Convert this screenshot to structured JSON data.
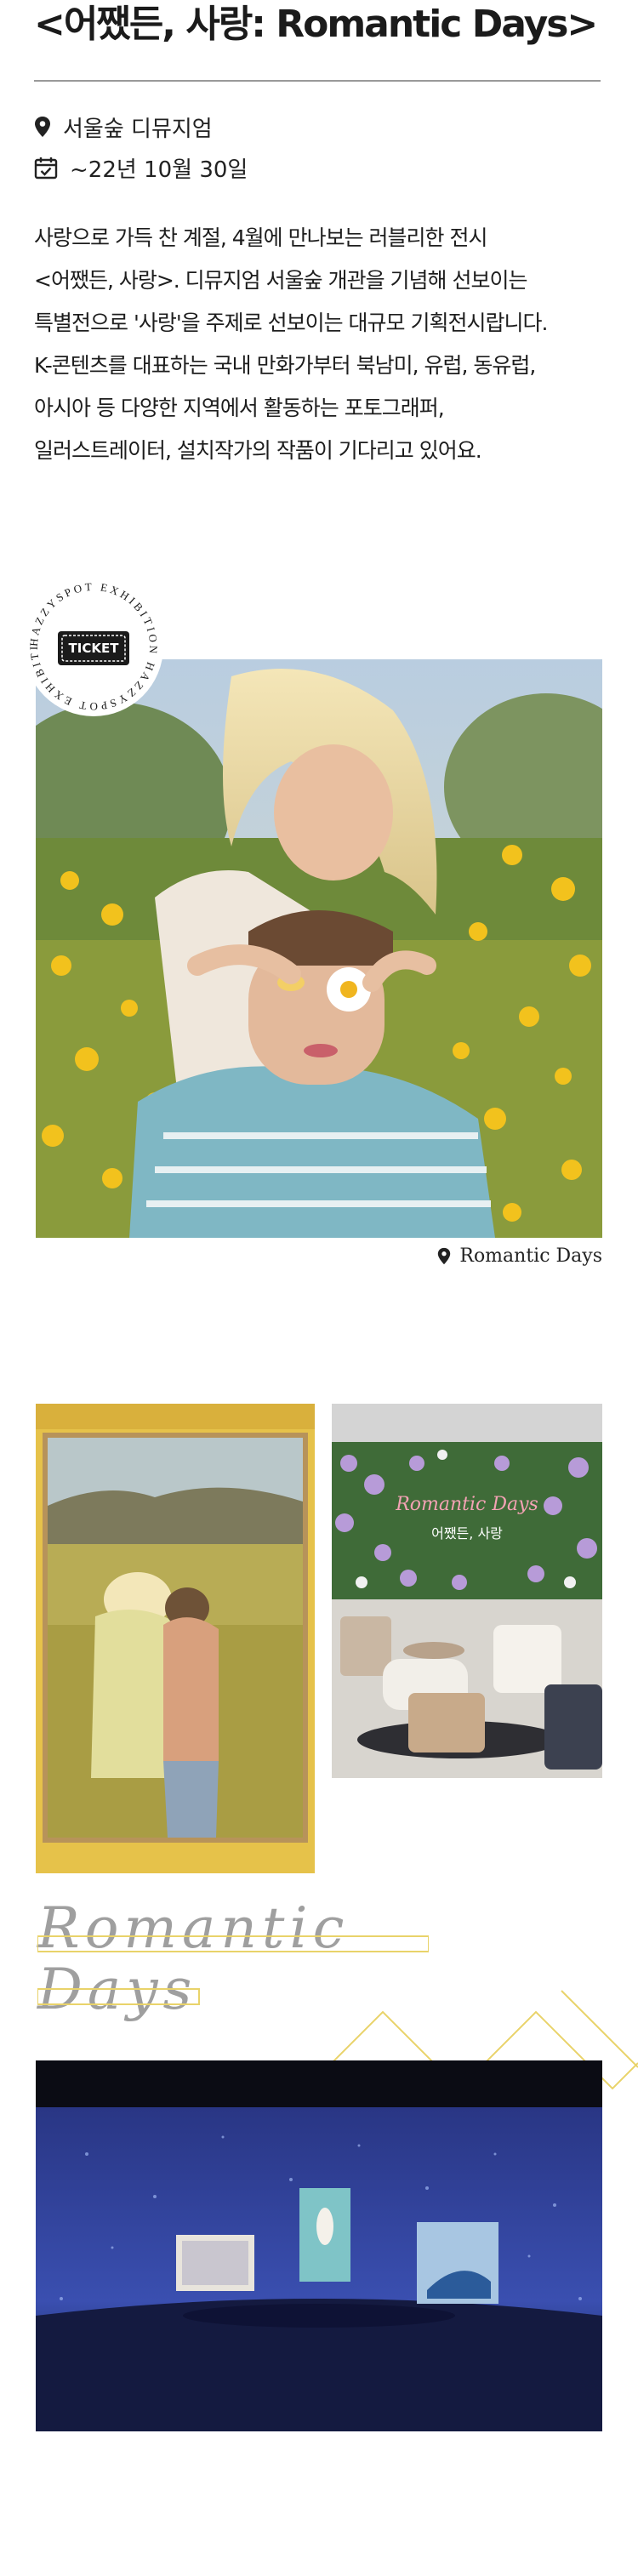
{
  "page": {
    "title": "<어쨌든, 사랑: Romantic Days>"
  },
  "info": {
    "venue": "서울숲 디뮤지엄",
    "date": "~22년 10월 30일",
    "venue_icon": "location-pin-icon",
    "date_icon": "calendar-check-icon"
  },
  "description": [
    "사랑으로 가득 찬 계절, 4월에 만나보는 러블리한 전시",
    "<어쨌든, 사랑>. 디뮤지엄 서울숲 개관을 기념해 선보이는",
    "특별전으로 '사랑'을 주제로 선보이는 대규모 기획전시랍니다.",
    "K-콘텐츠를 대표하는 국내 만화가부터 북남미, 유럽, 동유럽,",
    "아시아 등 다양한 지역에서 활동하는 포토그래퍼,",
    "일러스트레이터, 설치작가의 작품이 기다리고 있어요."
  ],
  "badge": {
    "ring_text": "HAZZYSPOT EXHIBITION HAZZYSPOT EXHIBITION",
    "center_label": "TICKET"
  },
  "photo_caption": "Romantic Days",
  "venue_sign": {
    "line1": "Romantic Days",
    "line2": "어쨌든, 사랑"
  },
  "script_text": {
    "line1": "Romantic",
    "line2": "Days"
  },
  "colors": {
    "accent_yellow": "#e9d36a",
    "text": "#1b1b1b",
    "rule": "#9a9a9a"
  }
}
